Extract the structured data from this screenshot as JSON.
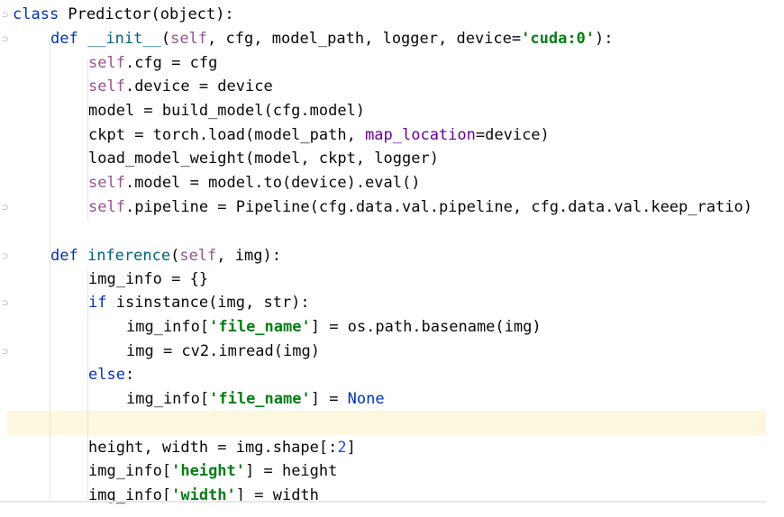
{
  "editor": {
    "lines": [
      {
        "tokens": [
          {
            "t": "class ",
            "c": "kw"
          },
          {
            "t": "Predictor",
            "c": "plain"
          },
          {
            "t": "(object):",
            "c": "plain"
          }
        ]
      },
      {
        "tokens": [
          {
            "t": "def ",
            "c": "kw"
          },
          {
            "t": "__init__",
            "c": "fn"
          },
          {
            "t": "(",
            "c": "plain"
          },
          {
            "t": "self",
            "c": "self"
          },
          {
            "t": ", ",
            "c": "plain"
          },
          {
            "t": "cfg",
            "c": "plain"
          },
          {
            "t": ", ",
            "c": "plain"
          },
          {
            "t": "model_path",
            "c": "plain"
          },
          {
            "t": ", ",
            "c": "plain"
          },
          {
            "t": "logger",
            "c": "plain"
          },
          {
            "t": ", ",
            "c": "plain"
          },
          {
            "t": "device=",
            "c": "plain"
          },
          {
            "t": "'cuda:0'",
            "c": "str"
          },
          {
            "t": "):",
            "c": "plain"
          }
        ]
      },
      {
        "tokens": [
          {
            "t": "self",
            "c": "self"
          },
          {
            "t": ".cfg = cfg",
            "c": "plain"
          }
        ]
      },
      {
        "tokens": [
          {
            "t": "self",
            "c": "self"
          },
          {
            "t": ".device = device",
            "c": "plain"
          }
        ]
      },
      {
        "tokens": [
          {
            "t": "model = build_model(cfg.model)",
            "c": "plain"
          }
        ]
      },
      {
        "tokens": [
          {
            "t": "ckpt",
            "c": "plain"
          },
          {
            "t": " = torch.load(model_path, ",
            "c": "plain"
          },
          {
            "t": "map_location",
            "c": "param"
          },
          {
            "t": "=device)",
            "c": "plain"
          }
        ]
      },
      {
        "tokens": [
          {
            "t": "load_model_weight(model, ckpt, logger)",
            "c": "plain"
          }
        ]
      },
      {
        "tokens": [
          {
            "t": "self",
            "c": "self"
          },
          {
            "t": ".model = model.to(device).eval()",
            "c": "plain"
          }
        ]
      },
      {
        "tokens": [
          {
            "t": "self",
            "c": "self"
          },
          {
            "t": ".pipeline = Pipeline(cfg.data.val.pipeline, cfg.data.val.keep_ratio)",
            "c": "plain"
          }
        ]
      },
      {
        "tokens": []
      },
      {
        "tokens": [
          {
            "t": "def ",
            "c": "kw"
          },
          {
            "t": "inference",
            "c": "fn"
          },
          {
            "t": "(",
            "c": "plain"
          },
          {
            "t": "self",
            "c": "self"
          },
          {
            "t": ", img):",
            "c": "plain"
          }
        ]
      },
      {
        "tokens": [
          {
            "t": "img_info = {}",
            "c": "plain"
          }
        ]
      },
      {
        "tokens": [
          {
            "t": "if ",
            "c": "kw"
          },
          {
            "t": "isinstance(img, str):",
            "c": "plain"
          }
        ]
      },
      {
        "tokens": [
          {
            "t": "img_info[",
            "c": "plain"
          },
          {
            "t": "'file_name'",
            "c": "str"
          },
          {
            "t": "] = os.path.basename(img)",
            "c": "plain"
          }
        ]
      },
      {
        "tokens": [
          {
            "t": "img = cv2.imread(img)",
            "c": "plain"
          }
        ]
      },
      {
        "tokens": [
          {
            "t": "else",
            "c": "kw"
          },
          {
            "t": ":",
            "c": "plain"
          }
        ]
      },
      {
        "tokens": [
          {
            "t": "img_info[",
            "c": "plain"
          },
          {
            "t": "'file_name'",
            "c": "str"
          },
          {
            "t": "] = ",
            "c": "plain"
          },
          {
            "t": "None",
            "c": "kw"
          }
        ]
      },
      {
        "tokens": []
      },
      {
        "tokens": [
          {
            "t": "height, width = img.shape[:",
            "c": "plain"
          },
          {
            "t": "2",
            "c": "num"
          },
          {
            "t": "]",
            "c": "plain"
          }
        ]
      },
      {
        "tokens": [
          {
            "t": "img_info[",
            "c": "plain"
          },
          {
            "t": "'height'",
            "c": "str"
          },
          {
            "t": "] = height",
            "c": "plain"
          }
        ]
      },
      {
        "tokens": [
          {
            "t": "img_info[",
            "c": "plain"
          },
          {
            "t": "'width'",
            "c": "str"
          },
          {
            "t": "] = width",
            "c": "plain"
          }
        ]
      }
    ]
  }
}
